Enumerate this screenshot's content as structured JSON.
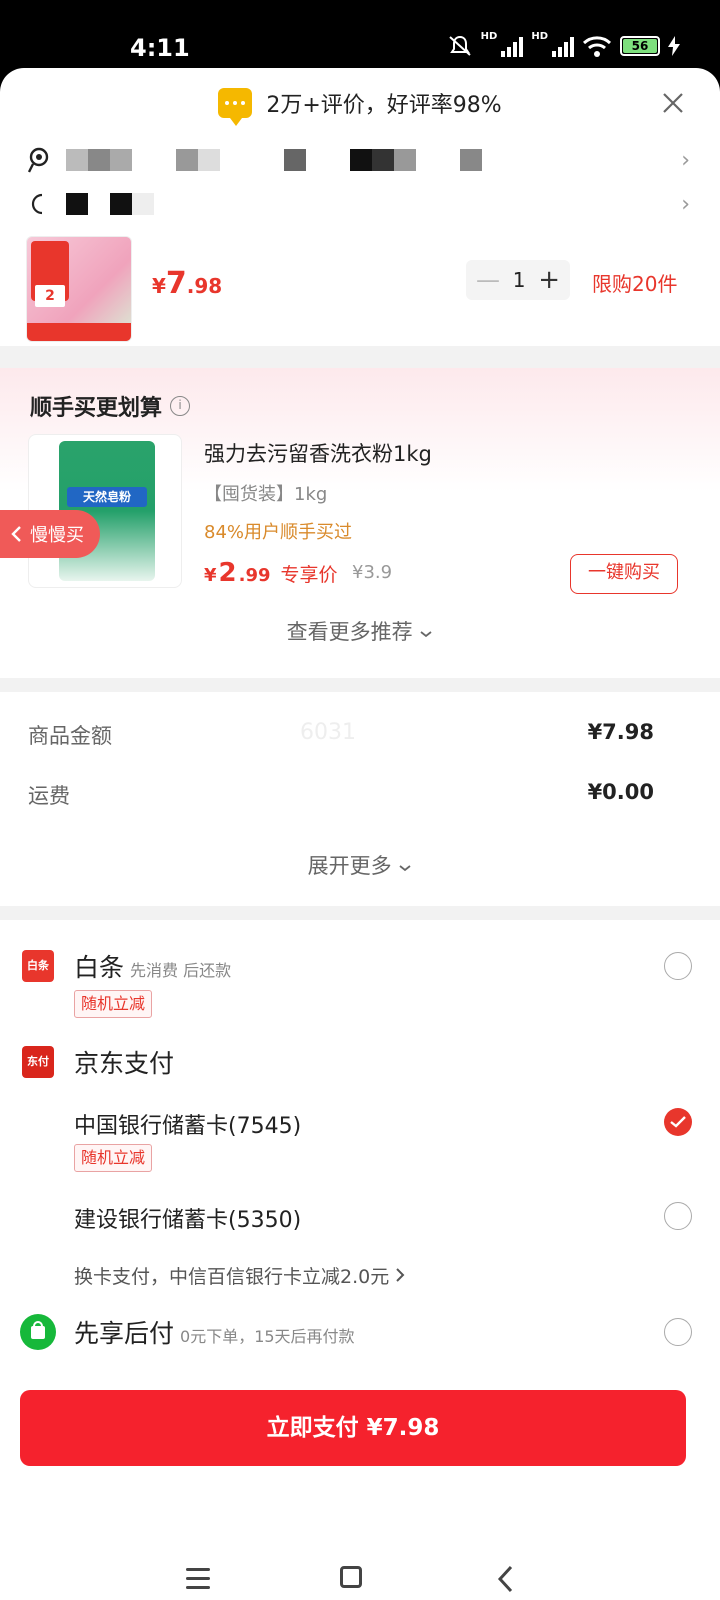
{
  "status_bar": {
    "time": "4:11",
    "battery": "56"
  },
  "review_bar": {
    "text": "2万+评价，好评率98%"
  },
  "product": {
    "price_symbol": "¥",
    "price_int": "7",
    "price_dec": ".98",
    "quantity": "1",
    "limit": "限购20件",
    "image_badge": "2"
  },
  "recommend": {
    "title": "顺手买更划算",
    "name": "强力去污留香洗衣粉1kg",
    "spec": "【囤货装】1kg",
    "percent": "84%用户顺手买过",
    "price_symbol": "¥",
    "price_int": "2",
    "price_dec": ".99",
    "exclusive": "专享价",
    "old_price": "¥3.9",
    "buy_button": "一键购买",
    "slow_buy": "慢慢买",
    "see_more": "查看更多推荐",
    "image_label": "天然皂粉"
  },
  "fees": {
    "watermark": "6031",
    "items": [
      {
        "label": "商品金额",
        "value": "¥7.98"
      },
      {
        "label": "运费",
        "value": "¥0.00"
      }
    ],
    "expand": "展开更多"
  },
  "payments": {
    "baitiao": {
      "icon": "白条",
      "title": "白条",
      "sub": "先消费 后还款",
      "badge": "随机立减"
    },
    "jdpay": {
      "icon": "东付",
      "title": "京东支付"
    },
    "card1": {
      "name": "中国银行储蓄卡(7545)",
      "badge": "随机立减"
    },
    "card2": {
      "name": "建设银行储蓄卡(5350)"
    },
    "switch_card": "换卡支付，中信百信银行卡立减2.0元",
    "xianxiang": {
      "title": "先享后付",
      "sub": "0元下单，15天后再付款"
    }
  },
  "pay_button": "立即支付 ¥7.98"
}
